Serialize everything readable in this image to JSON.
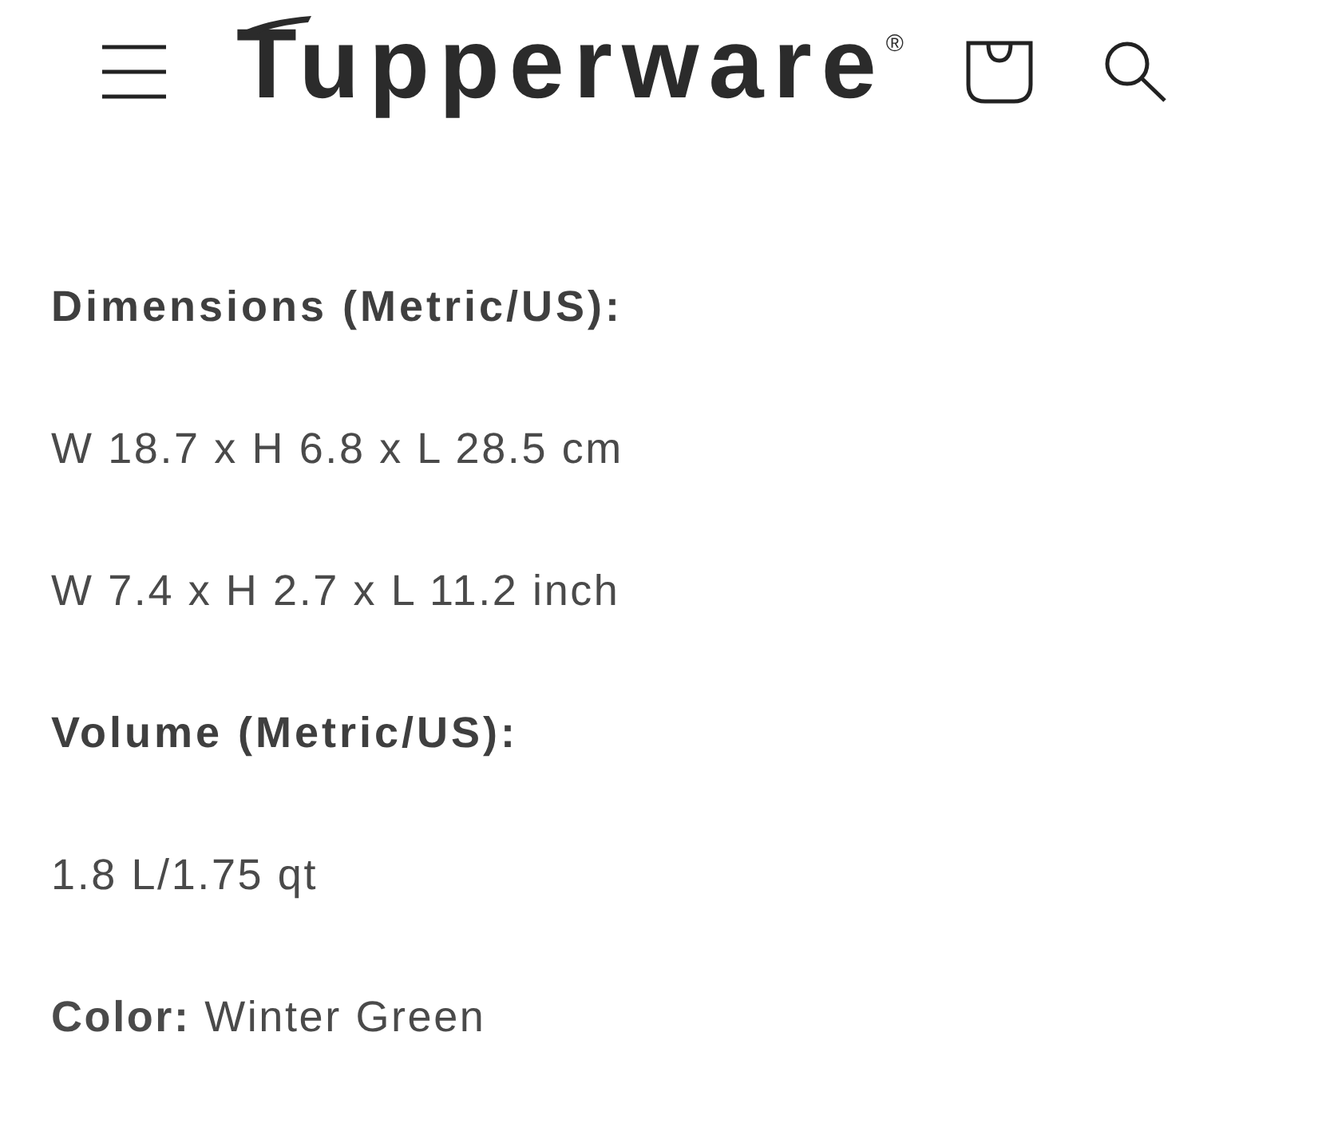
{
  "header": {
    "logo": "Tupperware$^{®}$"
  },
  "specs": [
    {
      "kind": "heading",
      "text": "Dimensions (Metric/US):"
    },
    {
      "kind": "value",
      "text": "W 18.7 x H 6.8 x L 28.5 cm"
    },
    {
      "kind": "value",
      "text": "W 7.4 x H 2.7 x L 11.2 inch"
    },
    {
      "kind": "heading",
      "text": "Volume (Metric/US):"
    },
    {
      "kind": "value",
      "text": "1.8 L/1.75 qt"
    },
    {
      "kind": "value",
      "text": "**Color:** Winter Green"
    }
  ]
}
